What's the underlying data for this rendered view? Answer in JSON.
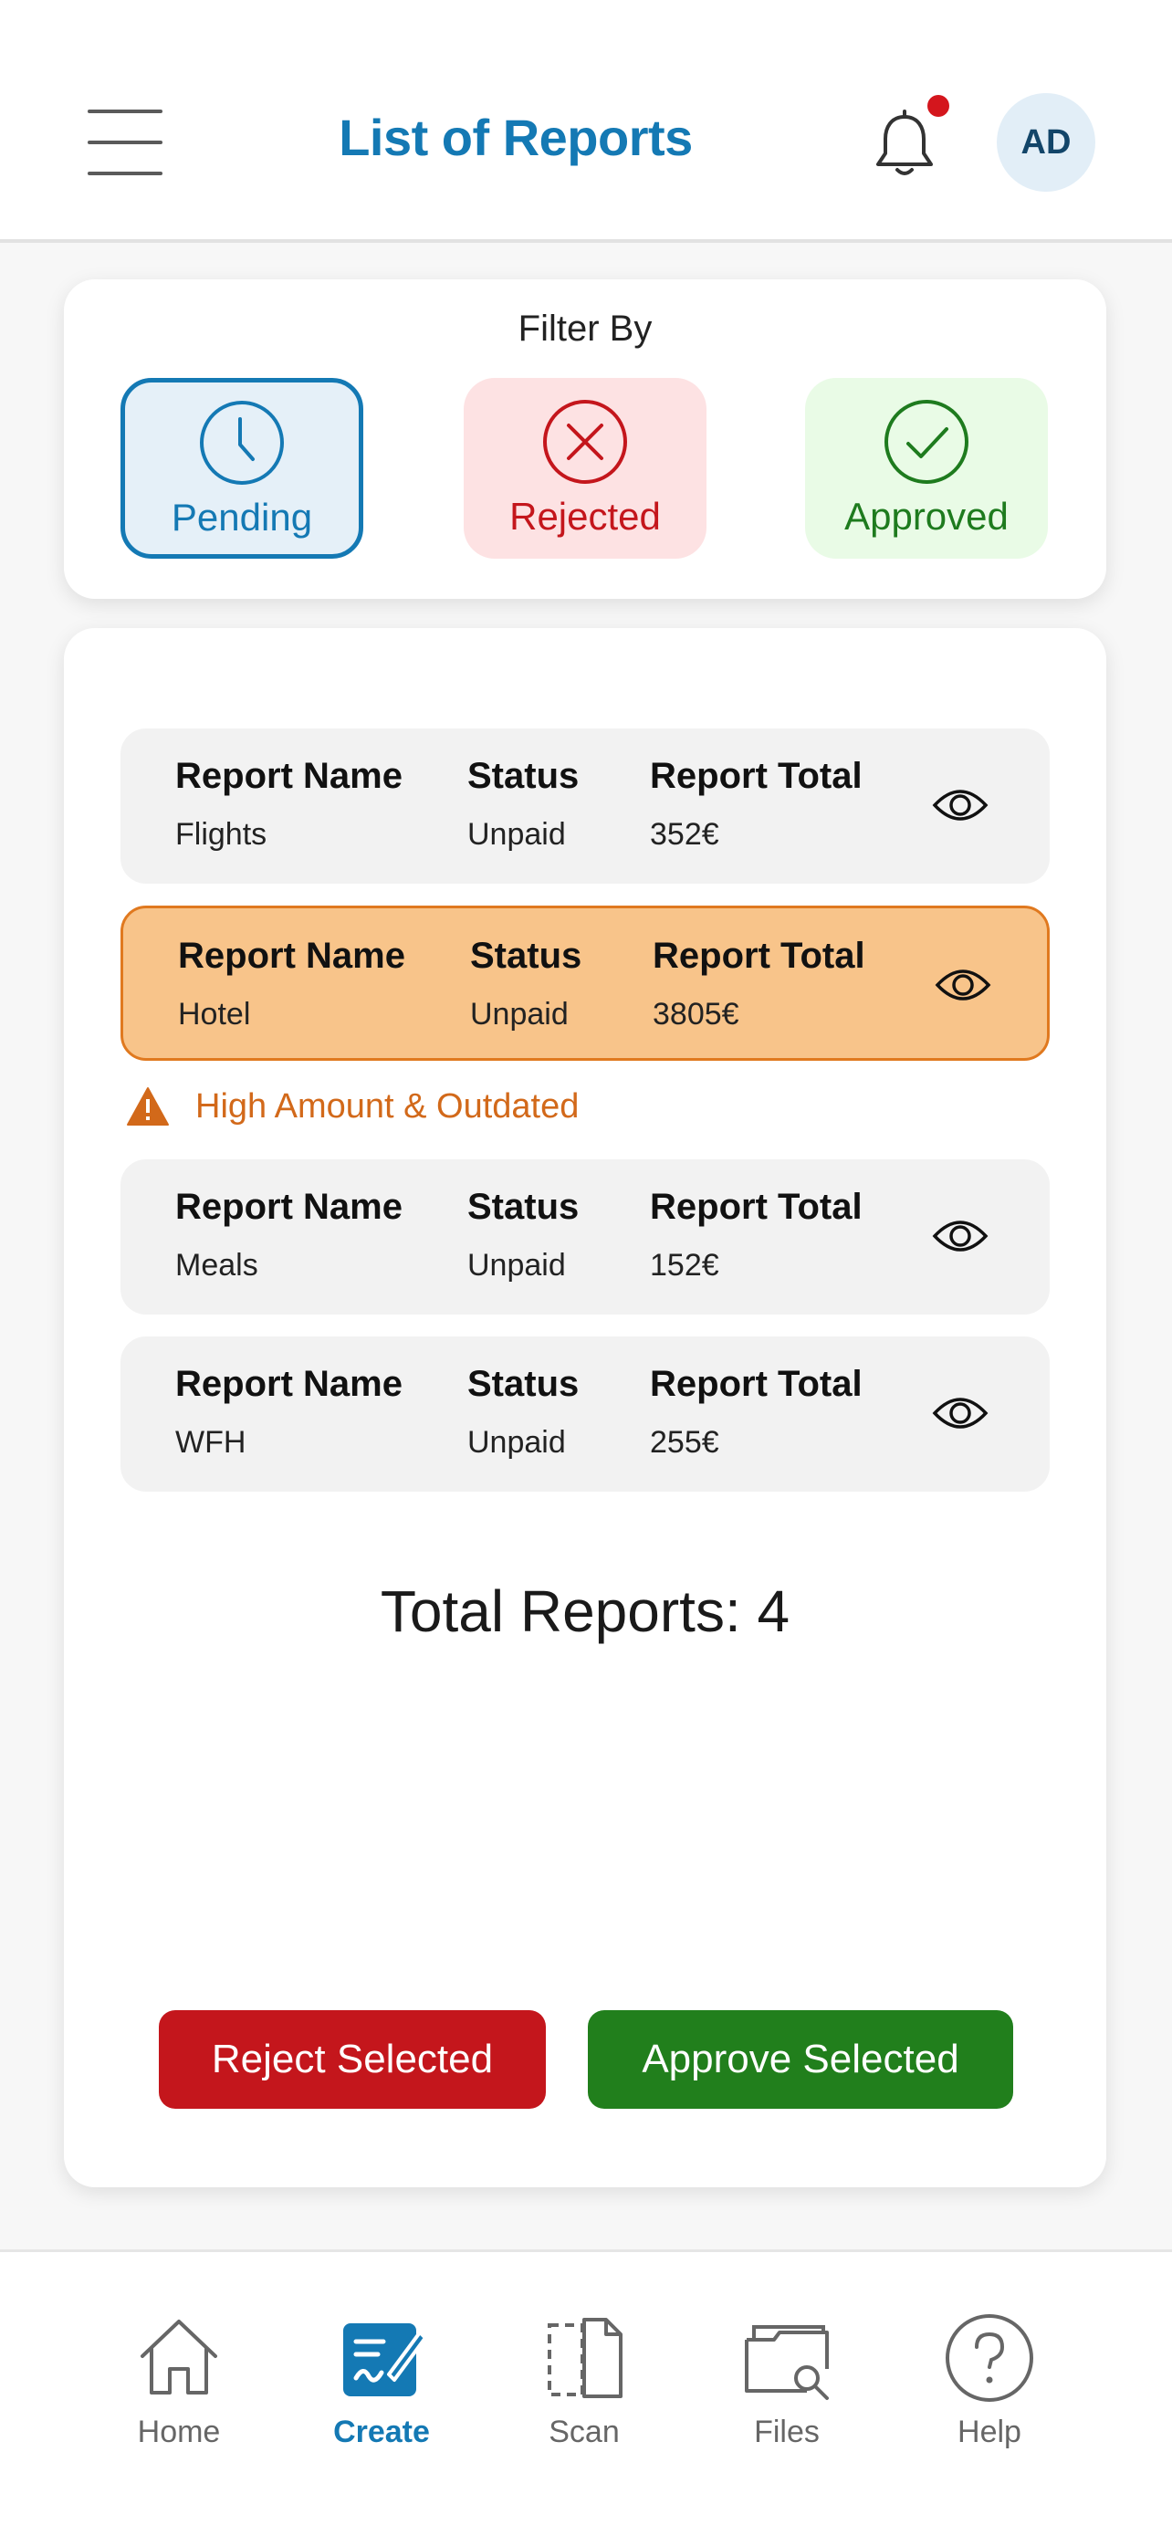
{
  "header": {
    "title": "List of Reports",
    "avatar_initials": "AD",
    "notification_dot_color": "#d4161d",
    "accent_color": "#1479b4"
  },
  "filter": {
    "title": "Filter By",
    "options": [
      {
        "label": "Pending",
        "icon": "clock-icon",
        "selected": true
      },
      {
        "label": "Rejected",
        "icon": "x-circle-icon",
        "selected": false
      },
      {
        "label": "Approved",
        "icon": "check-circle-icon",
        "selected": false
      }
    ]
  },
  "columns": {
    "name": "Report Name",
    "status": "Status",
    "total": "Report Total"
  },
  "reports": [
    {
      "name": "Flights",
      "status": "Unpaid",
      "total": "352€",
      "highlighted": false
    },
    {
      "name": "Hotel",
      "status": "Unpaid",
      "total": "3805€",
      "highlighted": true
    },
    {
      "name": "Meals",
      "status": "Unpaid",
      "total": "152€",
      "highlighted": false
    },
    {
      "name": "WFH",
      "status": "Unpaid",
      "total": "255€",
      "highlighted": false
    }
  ],
  "warning": {
    "text": "High Amount & Outdated",
    "icon": "warning-triangle-icon",
    "color": "#d2691a"
  },
  "total_text": "Total Reports: 4",
  "actions": {
    "reject_label": "Reject Selected",
    "reject_color": "#c4161c",
    "approve_label": "Approve Selected",
    "approve_color": "#217f1c"
  },
  "nav": [
    {
      "label": "Home",
      "icon": "home-icon",
      "active": false
    },
    {
      "label": "Create",
      "icon": "create-icon",
      "active": true
    },
    {
      "label": "Scan",
      "icon": "scan-icon",
      "active": false
    },
    {
      "label": "Files",
      "icon": "files-icon",
      "active": false
    },
    {
      "label": "Help",
      "icon": "help-icon",
      "active": false
    }
  ]
}
